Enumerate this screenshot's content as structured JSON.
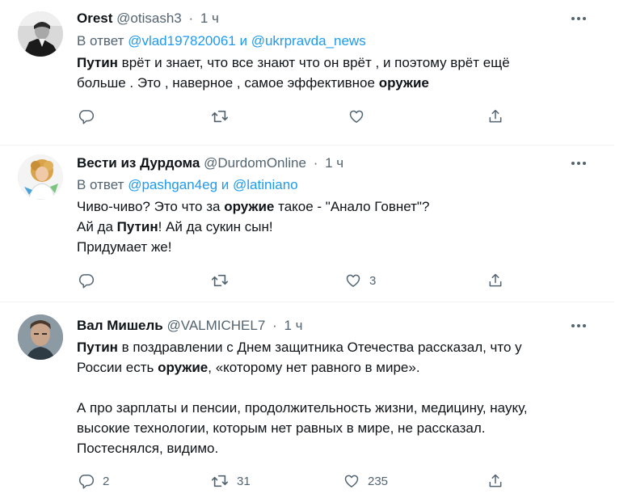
{
  "tweets": [
    {
      "name": "Orest",
      "handle": "@otisash3",
      "time": "1 ч",
      "reply_prefix": "В ответ",
      "reply_user1": "@vlad197820061",
      "reply_and": "и",
      "reply_user2": "@ukrpravda_news",
      "lines": [
        [
          {
            "t": "Путин",
            "b": true
          },
          {
            "t": " врёт и знает, что все знают что он врёт , и поэтому врёт ещё",
            "b": false
          }
        ],
        [
          {
            "t": "больше . Это , наверное , самое эффективное ",
            "b": false
          },
          {
            "t": "оружие",
            "b": true
          }
        ]
      ],
      "replies": "",
      "retweets": "",
      "likes": ""
    },
    {
      "name": "Вести из Дурдома",
      "handle": "@DurdomOnline",
      "time": "1 ч",
      "reply_prefix": "В ответ",
      "reply_user1": "@pashgan4eg",
      "reply_and": "и",
      "reply_user2": "@latiniano",
      "lines": [
        [
          {
            "t": "Чиво-чиво? Это что за ",
            "b": false
          },
          {
            "t": "оружие",
            "b": true
          },
          {
            "t": " такое - \"Анало Говнет\"?",
            "b": false
          }
        ],
        [
          {
            "t": "Ай да ",
            "b": false
          },
          {
            "t": "Путин",
            "b": true
          },
          {
            "t": "! Ай да сукин сын!",
            "b": false
          }
        ],
        [
          {
            "t": "Придумает же!",
            "b": false
          }
        ]
      ],
      "replies": "",
      "retweets": "",
      "likes": "3"
    },
    {
      "name": "Вал Мишель",
      "handle": "@VALMICHEL7",
      "time": "1 ч",
      "reply_prefix": "",
      "reply_user1": "",
      "reply_and": "",
      "reply_user2": "",
      "lines": [
        [
          {
            "t": "Путин",
            "b": true
          },
          {
            "t": " в поздравлении с Днем защитника Отечества рассказал, что у",
            "b": false
          }
        ],
        [
          {
            "t": "России есть ",
            "b": false
          },
          {
            "t": "оружие",
            "b": true
          },
          {
            "t": ", «которому нет равного в мире».",
            "b": false
          }
        ],
        [],
        [
          {
            "t": "А про зарплаты и пенсии, продолжительность жизни, медицину, науку,",
            "b": false
          }
        ],
        [
          {
            "t": "высокие технологии, которым нет равных в мире, не рассказал.",
            "b": false
          }
        ],
        [
          {
            "t": "Постеснялся, видимо.",
            "b": false
          }
        ]
      ],
      "replies": "2",
      "retweets": "31",
      "likes": "235"
    }
  ],
  "colors": {
    "text": "#0f1419",
    "secondary": "#536471",
    "link": "#1d9bf0",
    "divider": "#eff3f4"
  },
  "icons": [
    "more-icon",
    "reply-icon",
    "retweet-icon",
    "like-icon",
    "share-icon"
  ]
}
